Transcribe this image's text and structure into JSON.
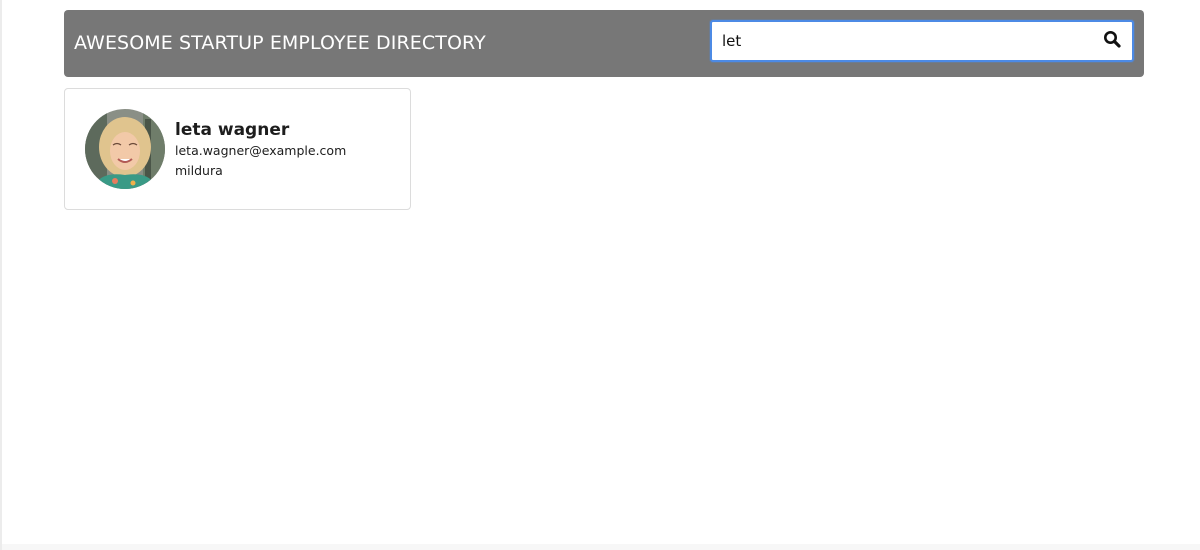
{
  "header": {
    "title": "AWESOME STARTUP EMPLOYEE DIRECTORY"
  },
  "search": {
    "value": "let",
    "icon": "search-icon"
  },
  "employees": [
    {
      "name": "leta wagner",
      "email": "leta.wagner@example.com",
      "city": "mildura"
    }
  ],
  "colors": {
    "header_bg": "#777777",
    "search_focus": "#4c8ae5"
  }
}
